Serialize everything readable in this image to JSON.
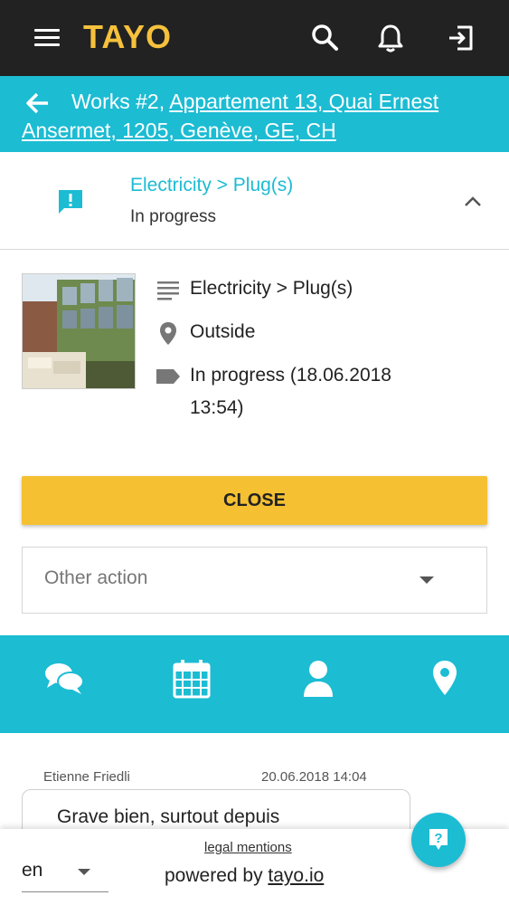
{
  "app": {
    "logo": "TAYO"
  },
  "header": {
    "title_prefix": "Works #2,",
    "title_address": "Appartement 13, Quai Ernest Ansermet, 1205, Genève, GE, CH"
  },
  "issue": {
    "category": "Electricity > Plug(s)",
    "status": "In progress",
    "details": {
      "category": "Electricity > Plug(s)",
      "location": "Outside",
      "status_line1": "In progress (18.06.2018",
      "status_line2": "13:54)"
    }
  },
  "actions": {
    "close_label": "CLOSE",
    "other_action_placeholder": "Other action"
  },
  "tabs": [
    {
      "icon": "chat-icon"
    },
    {
      "icon": "calendar-icon"
    },
    {
      "icon": "person-icon"
    },
    {
      "icon": "location-pin-icon"
    }
  ],
  "message": {
    "author": "Etienne Friedli",
    "date": "20.06.2018 14:04",
    "text": "Grave bien, surtout depuis"
  },
  "footer": {
    "language": "en",
    "legal_label": "legal mentions",
    "powered_prefix": "powered by",
    "powered_link": "tayo.io"
  },
  "colors": {
    "accent": "#1cbcd3",
    "brand_yellow": "#f6c13c",
    "topbar": "#222222",
    "close_button": "#f5c132"
  }
}
